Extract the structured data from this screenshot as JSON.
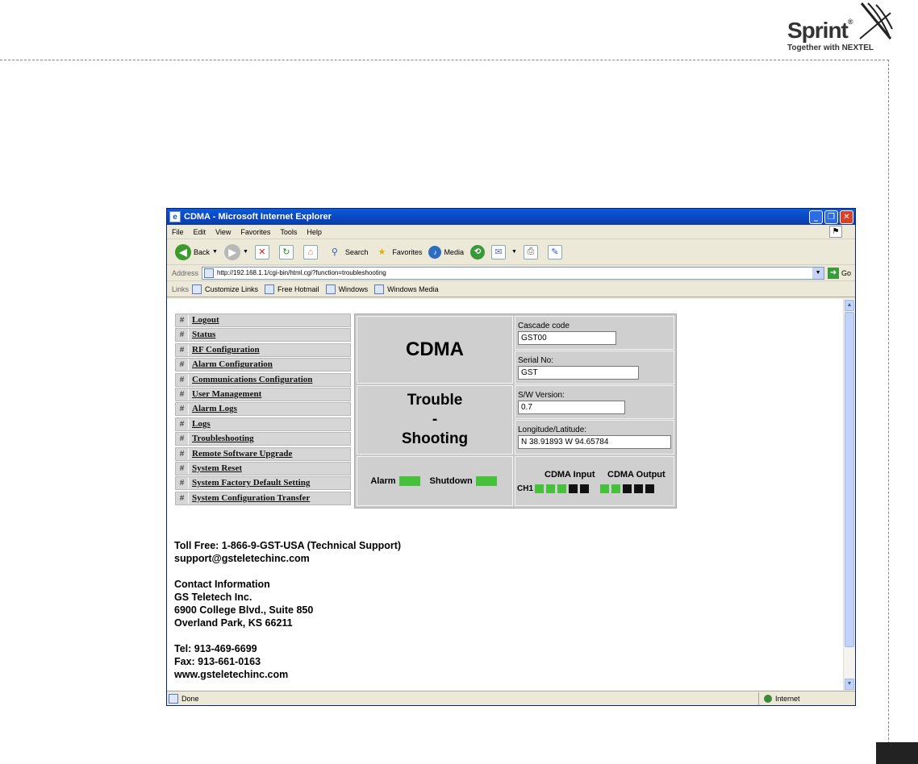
{
  "brand": {
    "name": "Sprint",
    "tagline": "Together with NEXTEL"
  },
  "window": {
    "title": "CDMA - Microsoft Internet Explorer",
    "menu": [
      "File",
      "Edit",
      "View",
      "Favorites",
      "Tools",
      "Help"
    ],
    "toolbar": {
      "back": "Back",
      "search": "Search",
      "favorites": "Favorites",
      "media": "Media"
    },
    "address": {
      "label": "Address",
      "url": "http://192.168.1.1/cgi-bin/html.cgi?function=troubleshooting",
      "go": "Go"
    },
    "links": {
      "label": "Links",
      "items": [
        "Customize Links",
        "Free Hotmail",
        "Windows",
        "Windows Media"
      ]
    },
    "status": {
      "text": "Done",
      "zone": "Internet"
    }
  },
  "nav": {
    "bullet": "#",
    "items": [
      "Logout",
      "Status",
      "RF Configuration",
      "Alarm Configuration",
      "Communications Configuration",
      "User Management",
      "Alarm Logs",
      "Logs",
      "Troubleshooting",
      "Remote Software Upgrade",
      "System Reset",
      "System Factory Default Setting",
      "System Configuration Transfer"
    ]
  },
  "panel": {
    "title": "CDMA",
    "subtitle_line1": "Trouble",
    "subtitle_line2": "-",
    "subtitle_line3": "Shooting",
    "cascade_label": "Cascade code",
    "cascade_value": "GST00",
    "serial_label": "Serial No:",
    "serial_value": "GST",
    "sw_label": "S/W Version:",
    "sw_value": "0.7",
    "geo_label": "Longitude/Latitude:",
    "geo_value": " N 38.91893 W 94.65784",
    "alarm_label": "Alarm",
    "shutdown_label": "Shutdown",
    "input_label": "CDMA Input",
    "output_label": "CDMA Output",
    "channel_label": "CH1",
    "alarm_color": "#45c23a",
    "shutdown_color": "#45c23a",
    "input_leds": [
      "#45c23a",
      "#45c23a",
      "#45c23a",
      "#111111",
      "#111111"
    ],
    "output_leds": [
      "#45c23a",
      "#45c23a",
      "#111111",
      "#111111",
      "#111111"
    ]
  },
  "contact": {
    "tollfree": "Toll Free: 1-866-9-GST-USA (Technical Support)",
    "email": "support@gsteletechinc.com",
    "heading": "Contact Information",
    "company": "GS Teletech Inc.",
    "street": "6900 College Blvd., Suite 850",
    "city": "Overland Park, KS 66211",
    "tel": "Tel: 913-469-6699",
    "fax": "Fax: 913-661-0163",
    "web": "www.gsteletechinc.com"
  }
}
